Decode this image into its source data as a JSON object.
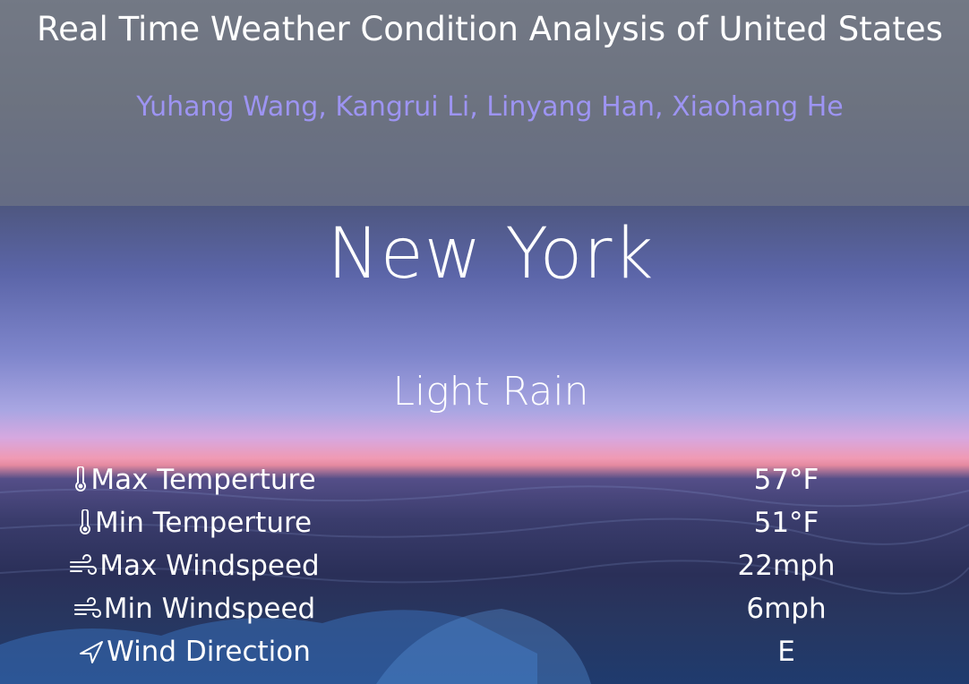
{
  "header": {
    "title": "Real Time Weather Condition Analysis of United States",
    "authors": "Yuhang Wang, Kangrui Li, Linyang Han, Xiaohang He"
  },
  "weather": {
    "city": "New York",
    "condition": "Light Rain",
    "stats": [
      {
        "label": "Max Temperture",
        "value": "57°F",
        "icon": "thermometer-icon"
      },
      {
        "label": "Min Temperture",
        "value": "51°F",
        "icon": "thermometer-icon"
      },
      {
        "label": "Max Windspeed",
        "value": "22mph",
        "icon": "wind-icon"
      },
      {
        "label": "Min Windspeed",
        "value": "6mph",
        "icon": "wind-icon"
      },
      {
        "label": "Wind Direction",
        "value": "E",
        "icon": "navigation-arrow-icon"
      }
    ]
  },
  "colors": {
    "authors": "#9d94f2",
    "header_overlay": "#787d87"
  }
}
